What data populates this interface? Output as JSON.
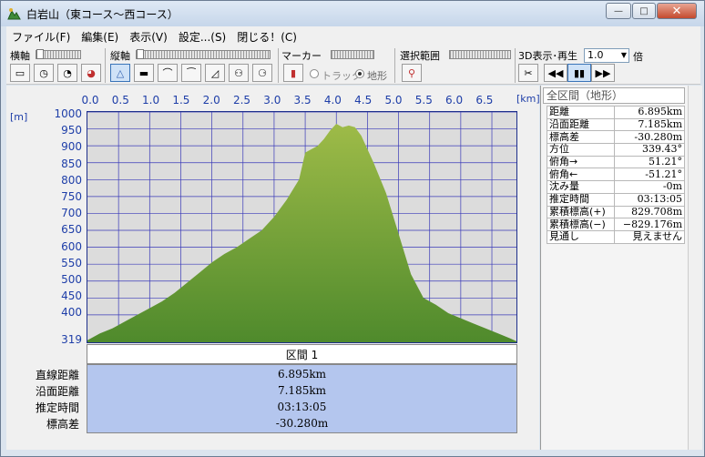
{
  "window": {
    "title": "白岩山（東コース～西コース）",
    "minimize": "—",
    "maximize": "□",
    "close": "✕"
  },
  "menu": [
    "ファイル(F)",
    "編集(E)",
    "表示(V)",
    "設定...(S)",
    "閉じる！(C)"
  ],
  "toolbar": {
    "horizontal_axis": "横軸",
    "vertical_axis": "縦軸",
    "marker": "マーカー",
    "track": "トラック",
    "terrain": "地形",
    "selection_range": "選択範囲",
    "display_3d": "3D表示･再生",
    "speed_value": "1.0",
    "speed_unit": "倍"
  },
  "graph": {
    "y_unit": "[m]",
    "x_unit": "[km]",
    "x_ticks": [
      "0.0",
      "0.5",
      "1.0",
      "1.5",
      "2.0",
      "2.5",
      "3.0",
      "3.5",
      "4.0",
      "4.5",
      "5.0",
      "5.5",
      "6.0",
      "6.5"
    ],
    "y_ticks": [
      "1000",
      "950",
      "900",
      "850",
      "800",
      "750",
      "700",
      "650",
      "600",
      "550",
      "500",
      "450",
      "400"
    ],
    "y_min_label": "319",
    "fill_top": "#9ebb48",
    "fill_bottom": "#4f8a2c"
  },
  "chart_data": {
    "type": "area",
    "xlabel": "[km]",
    "ylabel": "[m]",
    "xlim": [
      0,
      6.895
    ],
    "ylim": [
      319,
      1000
    ],
    "x": [
      0.0,
      0.2,
      0.4,
      0.6,
      0.8,
      1.0,
      1.2,
      1.4,
      1.6,
      1.8,
      2.0,
      2.2,
      2.4,
      2.6,
      2.8,
      3.0,
      3.2,
      3.4,
      3.5,
      3.6,
      3.7,
      3.8,
      3.9,
      4.0,
      4.1,
      4.2,
      4.3,
      4.4,
      4.6,
      4.8,
      5.0,
      5.2,
      5.4,
      5.6,
      5.8,
      6.0,
      6.2,
      6.4,
      6.6,
      6.8,
      6.895
    ],
    "y": [
      325,
      345,
      360,
      380,
      400,
      420,
      440,
      465,
      495,
      525,
      555,
      580,
      600,
      625,
      650,
      690,
      740,
      800,
      880,
      890,
      900,
      920,
      945,
      965,
      955,
      960,
      955,
      930,
      850,
      760,
      640,
      520,
      450,
      430,
      405,
      390,
      375,
      360,
      345,
      330,
      322
    ]
  },
  "section": {
    "header": "区間 1",
    "labels": [
      "直線距離",
      "沿面距離",
      "推定時間",
      "標高差"
    ],
    "values": [
      "6.895km",
      "7.185km",
      "03:13:05",
      "-30.280m"
    ]
  },
  "side_panel": {
    "title": "全区間（地形）",
    "rows": [
      {
        "label": "距離",
        "value": "6.895km"
      },
      {
        "label": "沿面距離",
        "value": "7.185km"
      },
      {
        "label": "標高差",
        "value": "-30.280m"
      },
      {
        "label": "方位",
        "value": "339.43°"
      },
      {
        "label": "俯角→",
        "value": "51.21°"
      },
      {
        "label": "俯角←",
        "value": "-51.21°"
      },
      {
        "label": "沈み量",
        "value": "-0m"
      },
      {
        "label": "推定時間",
        "value": "03:13:05"
      },
      {
        "label": "累積標高(+)",
        "value": "829.708m"
      },
      {
        "label": "累積標高(−)",
        "value": "−829.176m"
      },
      {
        "label": "見通し",
        "value": "見えません"
      }
    ]
  }
}
